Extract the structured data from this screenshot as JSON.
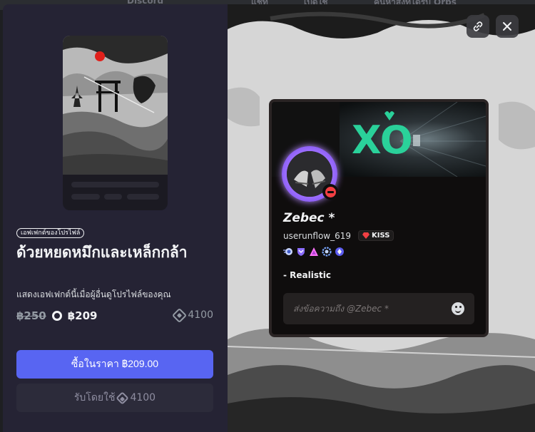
{
  "backdrop": {
    "app_title": "Discord",
    "tabs": [
      "แชท",
      "เปิดใช้",
      "ค้นหาสิ่งที่ได้รับ Orbs"
    ]
  },
  "product": {
    "tag": "เอฟเฟกต์ของโปรไฟล์",
    "title": "ด้วยหยดหมึกและเหล็กกล้า",
    "description": "แสดงเอฟเฟกต์นี้เมื่อผู้อื่นดูโปรไฟล์ของคุณ",
    "old_price": "฿250",
    "nitro_price": "฿209",
    "orb_price": "4100"
  },
  "actions": {
    "buy_label": "ซื้อในราคา ฿209.00",
    "redeem_label": "รับโดยใช้",
    "redeem_orbs": "4100",
    "copy_link_icon": "link-icon",
    "close_icon": "close-icon"
  },
  "profile": {
    "display_name": "Zebec *",
    "username": "userunflow_619",
    "clan_tag": "KISS",
    "bio": "- Realistic",
    "message_placeholder": "ส่งข้อความถึง @Zebec *",
    "status": "dnd",
    "banner_text": "XO",
    "badges": [
      "speed-badge",
      "shield-badge",
      "triangle-badge",
      "ring-badge",
      "diamond-badge"
    ]
  },
  "colors": {
    "accent": "#5865f2",
    "panel": "#252334",
    "avatar_ring": "#9a6cff",
    "dnd": "#f23f43",
    "banner_green": "#2ad19a"
  }
}
